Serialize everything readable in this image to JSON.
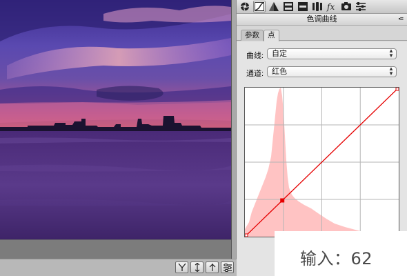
{
  "panel": {
    "title": "色调曲线",
    "menu_icon": "panel-menu-icon",
    "tabs": [
      {
        "label": "参数",
        "active": false
      },
      {
        "label": "点",
        "active": true
      }
    ],
    "toolbar_icons": [
      "aperture-icon",
      "tone-curve-icon",
      "detail-triangle-icon",
      "hsl-icon",
      "split-toning-icon",
      "lens-correction-icon",
      "effects-fx-icon",
      "camera-calibration-icon",
      "presets-icon"
    ],
    "curve_row": {
      "label": "曲线:",
      "value": "自定"
    },
    "channel_row": {
      "label": "通道:",
      "value": "红色"
    }
  },
  "curve": {
    "channel_color": "#e60000",
    "histogram_color": "#ffb3b3",
    "control_points": [
      {
        "input": 0,
        "output": 0
      },
      {
        "input": 62,
        "output": 62
      },
      {
        "input": 255,
        "output": 255
      }
    ]
  },
  "overlay": {
    "input_text": "输入：62"
  },
  "statusbar": {
    "icons": [
      "y-compare-icon",
      "swap-icon",
      "copy-settings-icon",
      "settings-toggle-icon"
    ]
  }
}
